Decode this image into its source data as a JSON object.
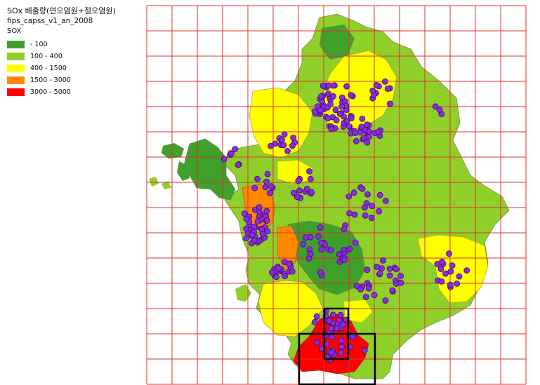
{
  "legend": {
    "title": "SOx 배출량(면오염원+점오염원)",
    "layer_name": "fips_capss_v1_an_2008",
    "field_name": "SOX",
    "classes": [
      {
        "label": "- 100",
        "color": "#3fa02c"
      },
      {
        "label": "100 - 400",
        "color": "#8fcf2a"
      },
      {
        "label": "400 - 1500",
        "color": "#ffff00"
      },
      {
        "label": "1500 - 3000",
        "color": "#ff8800"
      },
      {
        "label": "3000 - 5000",
        "color": "#ff0000"
      }
    ]
  },
  "map": {
    "grid_color": "#e03030",
    "point_color": "#8a2be2",
    "highlight_box_color": "#000000",
    "grid_columns": 15,
    "grid_rows": 15
  }
}
